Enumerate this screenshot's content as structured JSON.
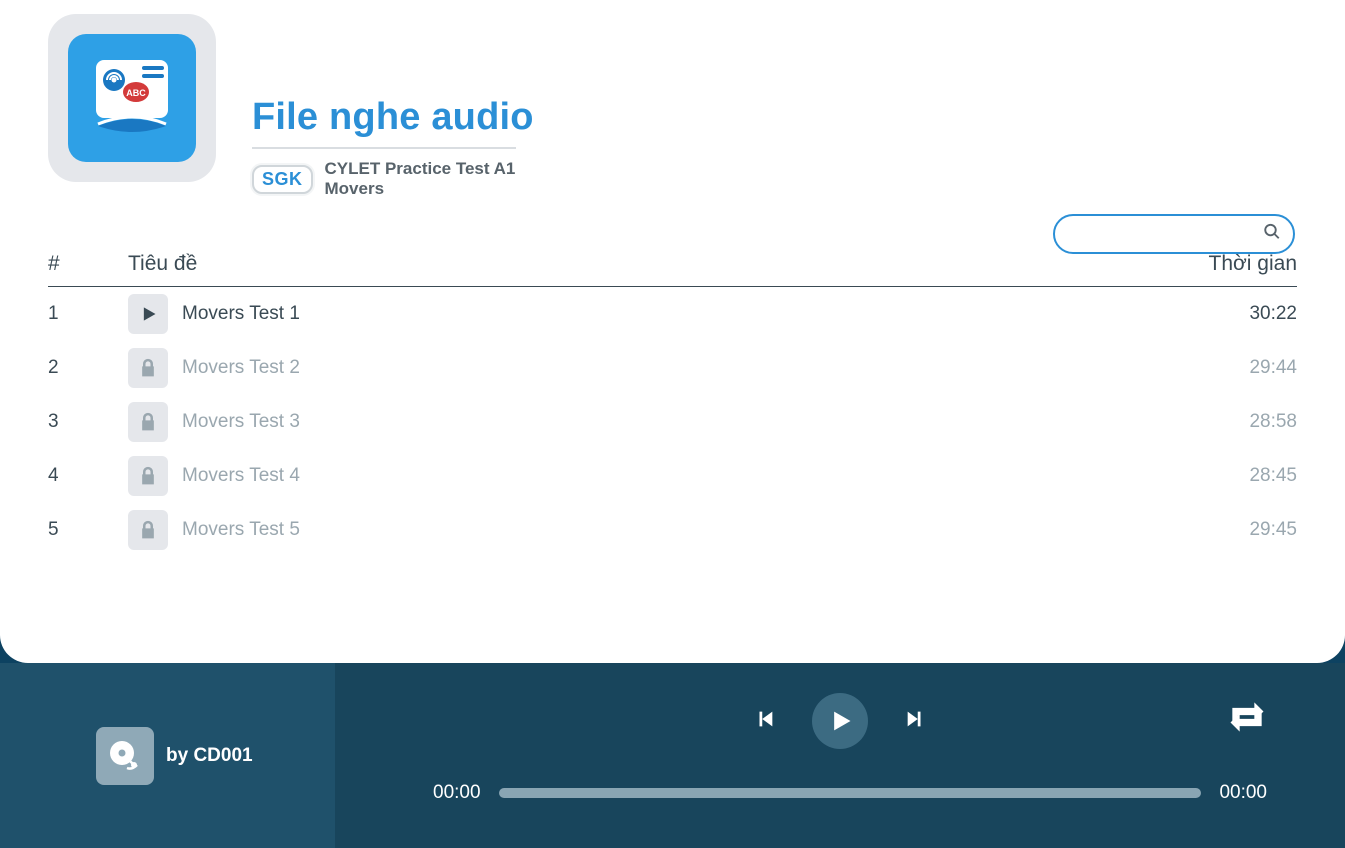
{
  "header": {
    "title": "File nghe audio",
    "badge": "SGK",
    "subtitle": "CYLET Practice Test A1 Movers"
  },
  "search": {
    "placeholder": ""
  },
  "table": {
    "columns": {
      "index": "#",
      "title": "Tiêu đề",
      "time": "Thời gian"
    },
    "rows": [
      {
        "num": "1",
        "title": "Movers Test 1",
        "time": "30:22",
        "locked": false
      },
      {
        "num": "2",
        "title": "Movers Test 2",
        "time": "29:44",
        "locked": true
      },
      {
        "num": "3",
        "title": "Movers Test 3",
        "time": "28:58",
        "locked": true
      },
      {
        "num": "4",
        "title": "Movers Test 4",
        "time": "28:45",
        "locked": true
      },
      {
        "num": "5",
        "title": "Movers Test 5",
        "time": "29:45",
        "locked": true
      }
    ]
  },
  "player": {
    "by_label": "by CD001",
    "elapsed": "00:00",
    "total": "00:00"
  }
}
